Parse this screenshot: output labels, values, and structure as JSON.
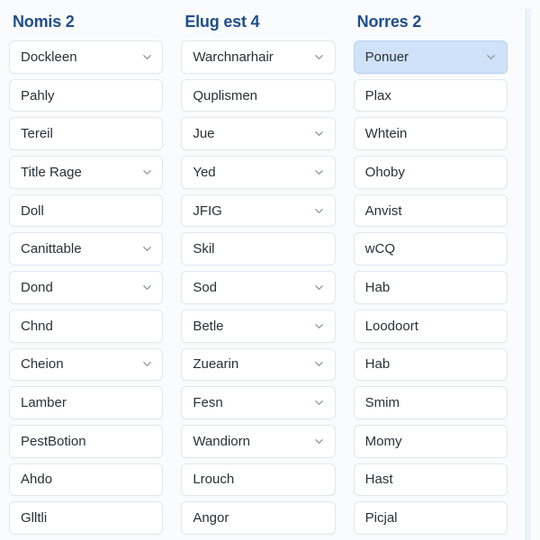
{
  "columns": [
    {
      "id": "nomis-2",
      "title": "Nomis 2",
      "cards": [
        {
          "label": "Dockleen",
          "chevron": true,
          "selected": false
        },
        {
          "label": "Pahly",
          "chevron": false,
          "selected": false
        },
        {
          "label": "Tereil",
          "chevron": false,
          "selected": false
        },
        {
          "label": "Title Rage",
          "chevron": true,
          "selected": false
        },
        {
          "label": "Doll",
          "chevron": false,
          "selected": false
        },
        {
          "label": "Canittable",
          "chevron": true,
          "selected": false
        },
        {
          "label": "Dond",
          "chevron": true,
          "selected": false
        },
        {
          "label": "Chnd",
          "chevron": false,
          "selected": false
        },
        {
          "label": "Cheion",
          "chevron": true,
          "selected": false
        },
        {
          "label": "Lamber",
          "chevron": false,
          "selected": false
        },
        {
          "label": "PestBotion",
          "chevron": false,
          "selected": false
        },
        {
          "label": "Ahdo",
          "chevron": false,
          "selected": false
        },
        {
          "label": "Glltli",
          "chevron": false,
          "selected": false
        }
      ]
    },
    {
      "id": "elug-est-4",
      "title": "Elug est 4",
      "cards": [
        {
          "label": "Warchnarhair",
          "chevron": true,
          "selected": false
        },
        {
          "label": "Quplismen",
          "chevron": false,
          "selected": false
        },
        {
          "label": "Jue",
          "chevron": true,
          "selected": false
        },
        {
          "label": "Yed",
          "chevron": true,
          "selected": false
        },
        {
          "label": "JFIG",
          "chevron": true,
          "selected": false
        },
        {
          "label": "Skil",
          "chevron": false,
          "selected": false
        },
        {
          "label": "Sod",
          "chevron": true,
          "selected": false
        },
        {
          "label": "Betle",
          "chevron": true,
          "selected": false
        },
        {
          "label": "Zuearin",
          "chevron": true,
          "selected": false
        },
        {
          "label": "Fesn",
          "chevron": true,
          "selected": false
        },
        {
          "label": "Wandiorn",
          "chevron": true,
          "selected": false
        },
        {
          "label": "Lrouch",
          "chevron": false,
          "selected": false
        },
        {
          "label": "Angor",
          "chevron": false,
          "selected": false
        }
      ]
    },
    {
      "id": "norres-2",
      "title": "Norres 2",
      "cards": [
        {
          "label": "Ponuer",
          "chevron": true,
          "selected": true
        },
        {
          "label": "Plax",
          "chevron": false,
          "selected": false
        },
        {
          "label": "Whtein",
          "chevron": false,
          "selected": false
        },
        {
          "label": "Ohoby",
          "chevron": false,
          "selected": false
        },
        {
          "label": "Anvist",
          "chevron": false,
          "selected": false
        },
        {
          "label": "wCQ",
          "chevron": false,
          "selected": false
        },
        {
          "label": "Hab",
          "chevron": false,
          "selected": false
        },
        {
          "label": "Loodoort",
          "chevron": false,
          "selected": false
        },
        {
          "label": "Hab",
          "chevron": false,
          "selected": false
        },
        {
          "label": "Smim",
          "chevron": false,
          "selected": false
        },
        {
          "label": "Momy",
          "chevron": false,
          "selected": false
        },
        {
          "label": "Hast",
          "chevron": false,
          "selected": false
        },
        {
          "label": "Picjal",
          "chevron": false,
          "selected": false
        }
      ]
    }
  ]
}
